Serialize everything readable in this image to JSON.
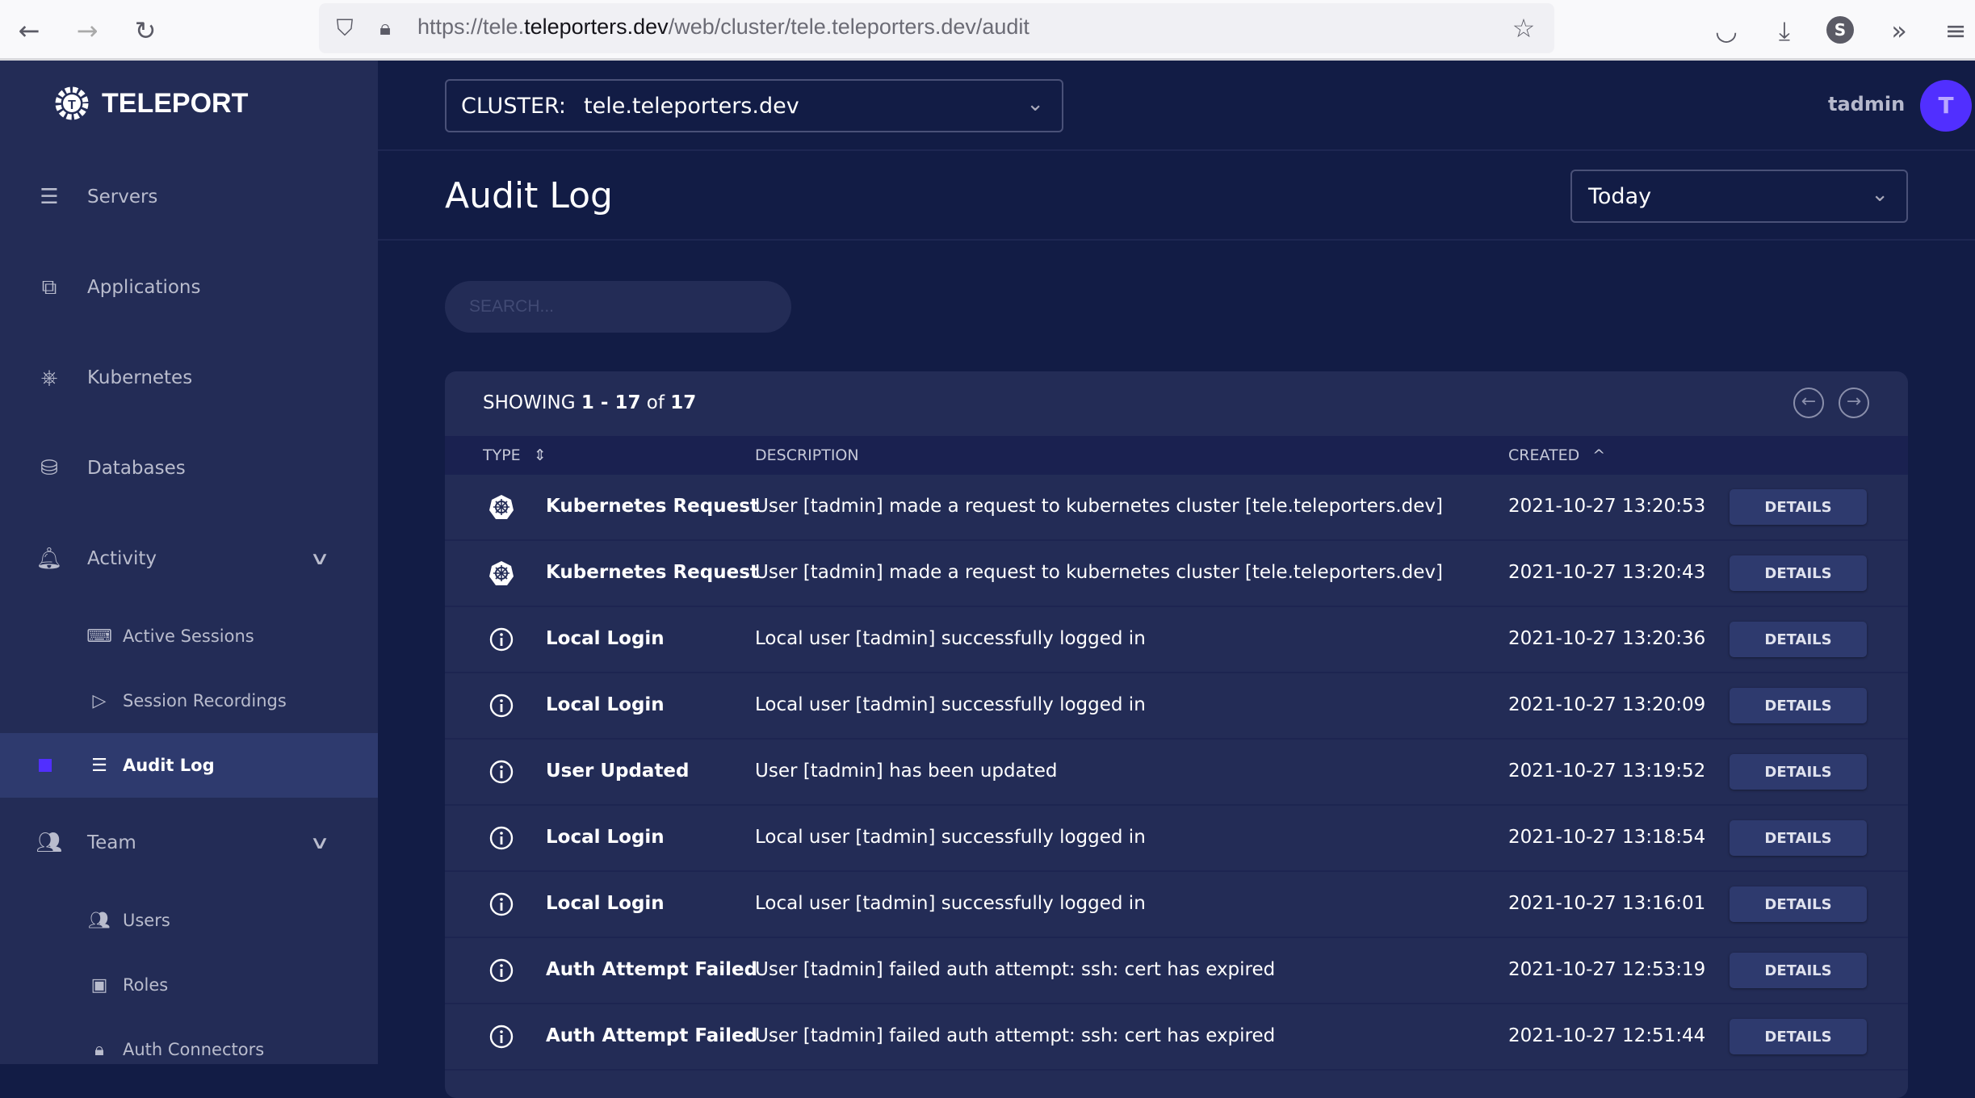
{
  "browser": {
    "url_prefix": "https://tele.",
    "url_domain": "teleporters.dev",
    "url_path": "/web/cluster/tele.teleporters.dev/audit",
    "profile_initial": "S"
  },
  "sidebar": {
    "brand": "TELEPORT",
    "items": [
      {
        "label": "Servers",
        "icon": "server-icon"
      },
      {
        "label": "Applications",
        "icon": "application-icon"
      },
      {
        "label": "Kubernetes",
        "icon": "kubernetes-icon"
      },
      {
        "label": "Databases",
        "icon": "database-icon"
      },
      {
        "label": "Activity",
        "icon": "bell-icon",
        "expanded": true
      },
      {
        "label": "Active Sessions",
        "icon": "terminal-icon"
      },
      {
        "label": "Session Recordings",
        "icon": "play-icon"
      },
      {
        "label": "Audit Log",
        "icon": "list-icon",
        "active": true
      },
      {
        "label": "Team",
        "icon": "users-icon",
        "expanded": true
      },
      {
        "label": "Users",
        "icon": "users-icon"
      },
      {
        "label": "Roles",
        "icon": "badge-icon"
      },
      {
        "label": "Auth Connectors",
        "icon": "lock-icon"
      }
    ]
  },
  "topbar": {
    "cluster_label": "CLUSTER:",
    "cluster_value": "tele.teleporters.dev",
    "username": "tadmin",
    "avatar_initial": "T"
  },
  "page": {
    "title": "Audit Log",
    "range": "Today",
    "search_placeholder": "SEARCH..."
  },
  "table": {
    "showing_prefix": "SHOWING ",
    "showing_range": "1 - 17",
    "showing_of": " of ",
    "showing_total": "17",
    "headers": {
      "type": "TYPE",
      "description": "DESCRIPTION",
      "created": "CREATED"
    },
    "details_label": "DETAILS",
    "rows": [
      {
        "icon": "kubernetes",
        "type": "Kubernetes Request",
        "description": "User [tadmin] made a request to kubernetes cluster [tele.teleporters.dev]",
        "created": "2021-10-27 13:20:53"
      },
      {
        "icon": "kubernetes",
        "type": "Kubernetes Request",
        "description": "User [tadmin] made a request to kubernetes cluster [tele.teleporters.dev]",
        "created": "2021-10-27 13:20:43"
      },
      {
        "icon": "info",
        "type": "Local Login",
        "description": "Local user [tadmin] successfully logged in",
        "created": "2021-10-27 13:20:36"
      },
      {
        "icon": "info",
        "type": "Local Login",
        "description": "Local user [tadmin] successfully logged in",
        "created": "2021-10-27 13:20:09"
      },
      {
        "icon": "info",
        "type": "User Updated",
        "description": "User [tadmin] has been updated",
        "created": "2021-10-27 13:19:52"
      },
      {
        "icon": "info",
        "type": "Local Login",
        "description": "Local user [tadmin] successfully logged in",
        "created": "2021-10-27 13:18:54"
      },
      {
        "icon": "info",
        "type": "Local Login",
        "description": "Local user [tadmin] successfully logged in",
        "created": "2021-10-27 13:16:01"
      },
      {
        "icon": "info",
        "type": "Auth Attempt Failed",
        "description": "User [tadmin] failed auth attempt: ssh: cert has expired",
        "created": "2021-10-27 12:53:19"
      },
      {
        "icon": "info",
        "type": "Auth Attempt Failed",
        "description": "User [tadmin] failed auth attempt: ssh: cert has expired",
        "created": "2021-10-27 12:51:44"
      }
    ]
  },
  "colors": {
    "accent": "#512fff",
    "sidebar": "#232c56",
    "background": "#121c45"
  }
}
